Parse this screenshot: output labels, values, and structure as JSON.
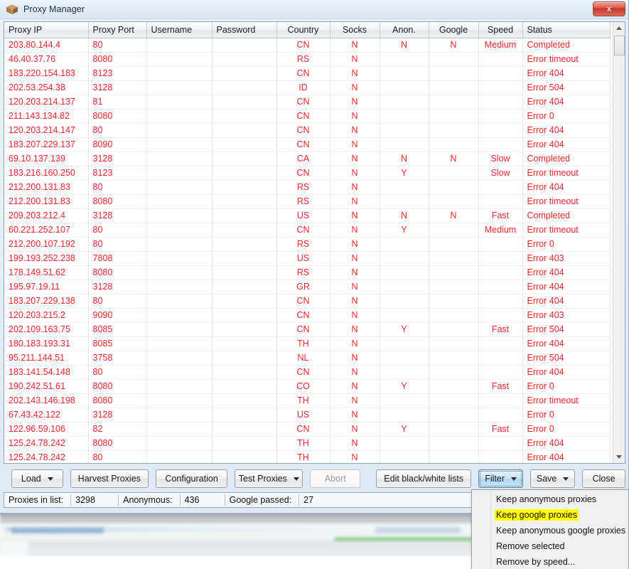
{
  "window": {
    "title": "Proxy Manager",
    "app_icon": "package-box-icon",
    "close_label": "x"
  },
  "grid": {
    "columns": [
      {
        "key": "ip",
        "label": "Proxy IP",
        "align": "left"
      },
      {
        "key": "port",
        "label": "Proxy Port",
        "align": "left"
      },
      {
        "key": "username",
        "label": "Username",
        "align": "left"
      },
      {
        "key": "password",
        "label": "Password",
        "align": "left"
      },
      {
        "key": "country",
        "label": "Country",
        "align": "center"
      },
      {
        "key": "socks",
        "label": "Socks",
        "align": "center"
      },
      {
        "key": "anon",
        "label": "Anon.",
        "align": "center"
      },
      {
        "key": "google",
        "label": "Google",
        "align": "center"
      },
      {
        "key": "speed",
        "label": "Speed",
        "align": "center"
      },
      {
        "key": "status",
        "label": "Status",
        "align": "left"
      }
    ],
    "row_color": "#f0262c",
    "rows": [
      {
        "ip": "203.80.144.4",
        "port": "80",
        "username": "",
        "password": "",
        "country": "CN",
        "socks": "N",
        "anon": "N",
        "google": "N",
        "speed": "Medium",
        "status": "Completed"
      },
      {
        "ip": "46.40.37.76",
        "port": "8080",
        "username": "",
        "password": "",
        "country": "RS",
        "socks": "N",
        "anon": "",
        "google": "",
        "speed": "",
        "status": "Error timeout"
      },
      {
        "ip": "183.220.154.183",
        "port": "8123",
        "username": "",
        "password": "",
        "country": "CN",
        "socks": "N",
        "anon": "",
        "google": "",
        "speed": "",
        "status": "Error 404"
      },
      {
        "ip": "202.53.254.38",
        "port": "3128",
        "username": "",
        "password": "",
        "country": "ID",
        "socks": "N",
        "anon": "",
        "google": "",
        "speed": "",
        "status": "Error 504"
      },
      {
        "ip": "120.203.214.137",
        "port": "81",
        "username": "",
        "password": "",
        "country": "CN",
        "socks": "N",
        "anon": "",
        "google": "",
        "speed": "",
        "status": "Error 404"
      },
      {
        "ip": "211.143.134.82",
        "port": "8080",
        "username": "",
        "password": "",
        "country": "CN",
        "socks": "N",
        "anon": "",
        "google": "",
        "speed": "",
        "status": "Error 0"
      },
      {
        "ip": "120.203.214.147",
        "port": "80",
        "username": "",
        "password": "",
        "country": "CN",
        "socks": "N",
        "anon": "",
        "google": "",
        "speed": "",
        "status": "Error 404"
      },
      {
        "ip": "183.207.229.137",
        "port": "8090",
        "username": "",
        "password": "",
        "country": "CN",
        "socks": "N",
        "anon": "",
        "google": "",
        "speed": "",
        "status": "Error 404"
      },
      {
        "ip": "69.10.137.139",
        "port": "3128",
        "username": "",
        "password": "",
        "country": "CA",
        "socks": "N",
        "anon": "N",
        "google": "N",
        "speed": "Slow",
        "status": "Completed"
      },
      {
        "ip": "183.216.160.250",
        "port": "8123",
        "username": "",
        "password": "",
        "country": "CN",
        "socks": "N",
        "anon": "Y",
        "google": "",
        "speed": "Slow",
        "status": "Error timeout"
      },
      {
        "ip": "212.200.131.83",
        "port": "80",
        "username": "",
        "password": "",
        "country": "RS",
        "socks": "N",
        "anon": "",
        "google": "",
        "speed": "",
        "status": "Error 404"
      },
      {
        "ip": "212.200.131.83",
        "port": "8080",
        "username": "",
        "password": "",
        "country": "RS",
        "socks": "N",
        "anon": "",
        "google": "",
        "speed": "",
        "status": "Error timeout"
      },
      {
        "ip": "209.203.212.4",
        "port": "3128",
        "username": "",
        "password": "",
        "country": "US",
        "socks": "N",
        "anon": "N",
        "google": "N",
        "speed": "Fast",
        "status": "Completed"
      },
      {
        "ip": "60.221.252.107",
        "port": "80",
        "username": "",
        "password": "",
        "country": "CN",
        "socks": "N",
        "anon": "Y",
        "google": "",
        "speed": "Medium",
        "status": "Error timeout"
      },
      {
        "ip": "212.200.107.192",
        "port": "80",
        "username": "",
        "password": "",
        "country": "RS",
        "socks": "N",
        "anon": "",
        "google": "",
        "speed": "",
        "status": "Error 0"
      },
      {
        "ip": "199.193.252.238",
        "port": "7808",
        "username": "",
        "password": "",
        "country": "US",
        "socks": "N",
        "anon": "",
        "google": "",
        "speed": "",
        "status": "Error 403"
      },
      {
        "ip": "178.149.51.62",
        "port": "8080",
        "username": "",
        "password": "",
        "country": "RS",
        "socks": "N",
        "anon": "",
        "google": "",
        "speed": "",
        "status": "Error 404"
      },
      {
        "ip": "195.97.19.11",
        "port": "3128",
        "username": "",
        "password": "",
        "country": "GR",
        "socks": "N",
        "anon": "",
        "google": "",
        "speed": "",
        "status": "Error 404"
      },
      {
        "ip": "183.207.229.138",
        "port": "80",
        "username": "",
        "password": "",
        "country": "CN",
        "socks": "N",
        "anon": "",
        "google": "",
        "speed": "",
        "status": "Error 404"
      },
      {
        "ip": "120.203.215.2",
        "port": "9090",
        "username": "",
        "password": "",
        "country": "CN",
        "socks": "N",
        "anon": "",
        "google": "",
        "speed": "",
        "status": "Error 403"
      },
      {
        "ip": "202.109.163.75",
        "port": "8085",
        "username": "",
        "password": "",
        "country": "CN",
        "socks": "N",
        "anon": "Y",
        "google": "",
        "speed": "Fast",
        "status": "Error 504"
      },
      {
        "ip": "180.183.193.31",
        "port": "8085",
        "username": "",
        "password": "",
        "country": "TH",
        "socks": "N",
        "anon": "",
        "google": "",
        "speed": "",
        "status": "Error 404"
      },
      {
        "ip": "95.211.144.51",
        "port": "3758",
        "username": "",
        "password": "",
        "country": "NL",
        "socks": "N",
        "anon": "",
        "google": "",
        "speed": "",
        "status": "Error 504"
      },
      {
        "ip": "183.141.54.148",
        "port": "80",
        "username": "",
        "password": "",
        "country": "CN",
        "socks": "N",
        "anon": "",
        "google": "",
        "speed": "",
        "status": "Error 404"
      },
      {
        "ip": "190.242.51.61",
        "port": "8080",
        "username": "",
        "password": "",
        "country": "CO",
        "socks": "N",
        "anon": "Y",
        "google": "",
        "speed": "Fast",
        "status": "Error 0"
      },
      {
        "ip": "202.143.146.198",
        "port": "8080",
        "username": "",
        "password": "",
        "country": "TH",
        "socks": "N",
        "anon": "",
        "google": "",
        "speed": "",
        "status": "Error timeout"
      },
      {
        "ip": "67.43.42.122",
        "port": "3128",
        "username": "",
        "password": "",
        "country": "US",
        "socks": "N",
        "anon": "",
        "google": "",
        "speed": "",
        "status": "Error 0"
      },
      {
        "ip": "122.96.59.106",
        "port": "82",
        "username": "",
        "password": "",
        "country": "CN",
        "socks": "N",
        "anon": "Y",
        "google": "",
        "speed": "Fast",
        "status": "Error 0"
      },
      {
        "ip": "125.24.78.242",
        "port": "8080",
        "username": "",
        "password": "",
        "country": "TH",
        "socks": "N",
        "anon": "",
        "google": "",
        "speed": "",
        "status": "Error 404"
      },
      {
        "ip": "125.24.78.242",
        "port": "80",
        "username": "",
        "password": "",
        "country": "TH",
        "socks": "N",
        "anon": "",
        "google": "",
        "speed": "",
        "status": "Error 404"
      }
    ]
  },
  "scrollbar": {
    "up_arrow": "scroll-up-arrow-icon",
    "down_arrow": "scroll-down-arrow-icon"
  },
  "toolbar": {
    "load": "Load",
    "harvest": "Harvest Proxies",
    "configuration": "Configuration",
    "test": "Test Proxies",
    "abort": "Abort",
    "edit_lists": "Edit black/white lists",
    "filter": "Filter",
    "save": "Save",
    "close": "Close"
  },
  "status_bar": {
    "proxies_label": "Proxies in list:",
    "proxies_value": "3298",
    "anonymous_label": "Anonymous:",
    "anonymous_value": "436",
    "google_label": "Google passed:",
    "google_value": "27"
  },
  "filter_menu": {
    "items": [
      {
        "label": "Keep anonymous proxies",
        "highlighted": false
      },
      {
        "label": "Keep google proxies",
        "highlighted": true
      },
      {
        "label": "Keep anonymous google proxies",
        "highlighted": false
      },
      {
        "label": "Remove selected",
        "highlighted": false
      },
      {
        "label": "Remove by speed...",
        "highlighted": false
      }
    ],
    "highlight_color": "#ffff00"
  }
}
